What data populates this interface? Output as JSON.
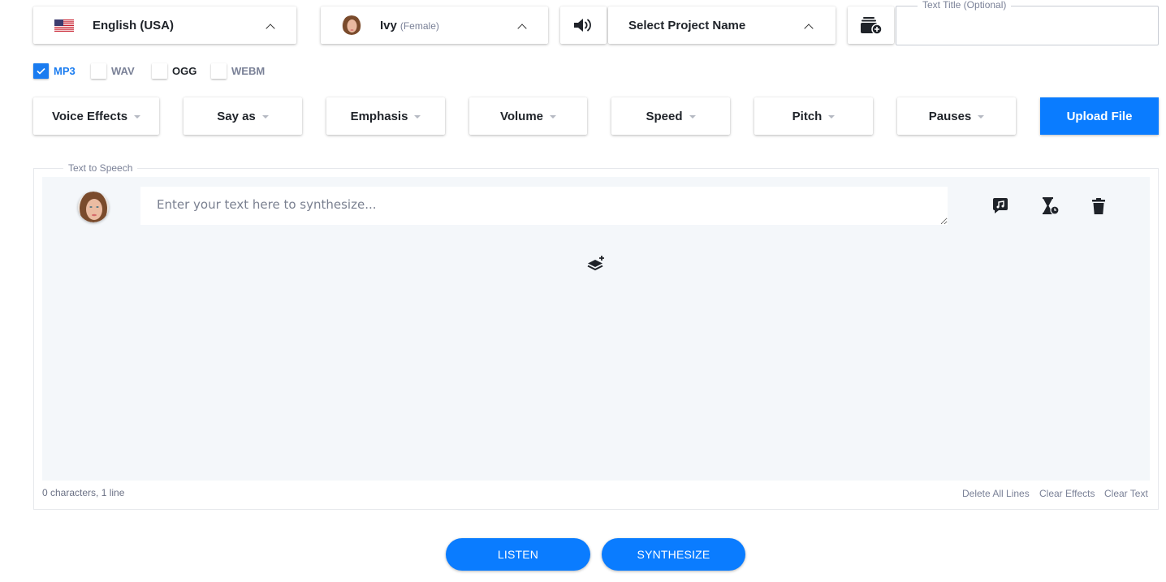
{
  "toolbar": {
    "language": {
      "label": "English (USA)",
      "flag": "us-flag-icon"
    },
    "voice": {
      "name": "Ivy",
      "gender": "(Female)"
    },
    "project": {
      "label": "Select Project Name"
    },
    "title_field": {
      "legend": "Text Title (Optional)",
      "value": "",
      "placeholder": ""
    }
  },
  "formats": [
    {
      "label": "MP3",
      "checked": true
    },
    {
      "label": "WAV",
      "checked": false
    },
    {
      "label": "OGG",
      "checked": false
    },
    {
      "label": "WEBM",
      "checked": false
    }
  ],
  "effects": [
    {
      "label": "Voice Effects"
    },
    {
      "label": "Say as"
    },
    {
      "label": "Emphasis"
    },
    {
      "label": "Volume"
    },
    {
      "label": "Speed"
    },
    {
      "label": "Pitch"
    },
    {
      "label": "Pauses"
    }
  ],
  "upload_label": "Upload File",
  "tts": {
    "legend": "Text to Speech",
    "placeholder": "Enter your text here to synthesize...",
    "counter": "0 characters, 1 line",
    "links": [
      "Delete All Lines",
      "Clear Effects",
      "Clear Text"
    ]
  },
  "actions": {
    "listen": "LISTEN",
    "synthesize": "SYNTHESIZE"
  },
  "colors": {
    "accent": "#0a7cff",
    "muted_text": "#7a8197",
    "editor_bg": "#f4f7fa"
  }
}
